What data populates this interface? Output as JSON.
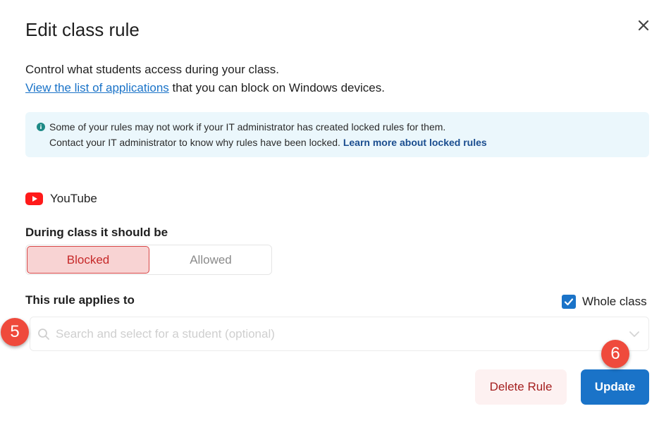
{
  "dialog": {
    "title": "Edit class rule",
    "description_line1": "Control what students access during your class.",
    "description_link": "View the list of applications",
    "description_line2_suffix": " that you can block on Windows devices."
  },
  "info": {
    "line1": "Some of your rules may not work if your IT administrator has created locked rules for them.",
    "line2": "Contact your IT administrator to know why rules have been locked. ",
    "link": "Learn more about locked rules"
  },
  "app": {
    "name": "YouTube",
    "icon": "youtube-icon"
  },
  "access": {
    "label": "During class it should be",
    "options": [
      "Blocked",
      "Allowed"
    ],
    "selected": "Blocked"
  },
  "applies": {
    "label": "This rule applies to",
    "whole_class_label": "Whole class",
    "whole_class_checked": true,
    "search_placeholder": "Search and select for a student (optional)",
    "search_value": ""
  },
  "actions": {
    "delete_label": "Delete Rule",
    "update_label": "Update"
  },
  "annotations": {
    "step5": "5",
    "step6": "6"
  },
  "colors": {
    "accent": "#1a73c8",
    "blocked_bg": "#f8d3d3",
    "blocked_text": "#c62828",
    "badge": "#ef4a3c",
    "info_bg": "#ebf7fc"
  }
}
